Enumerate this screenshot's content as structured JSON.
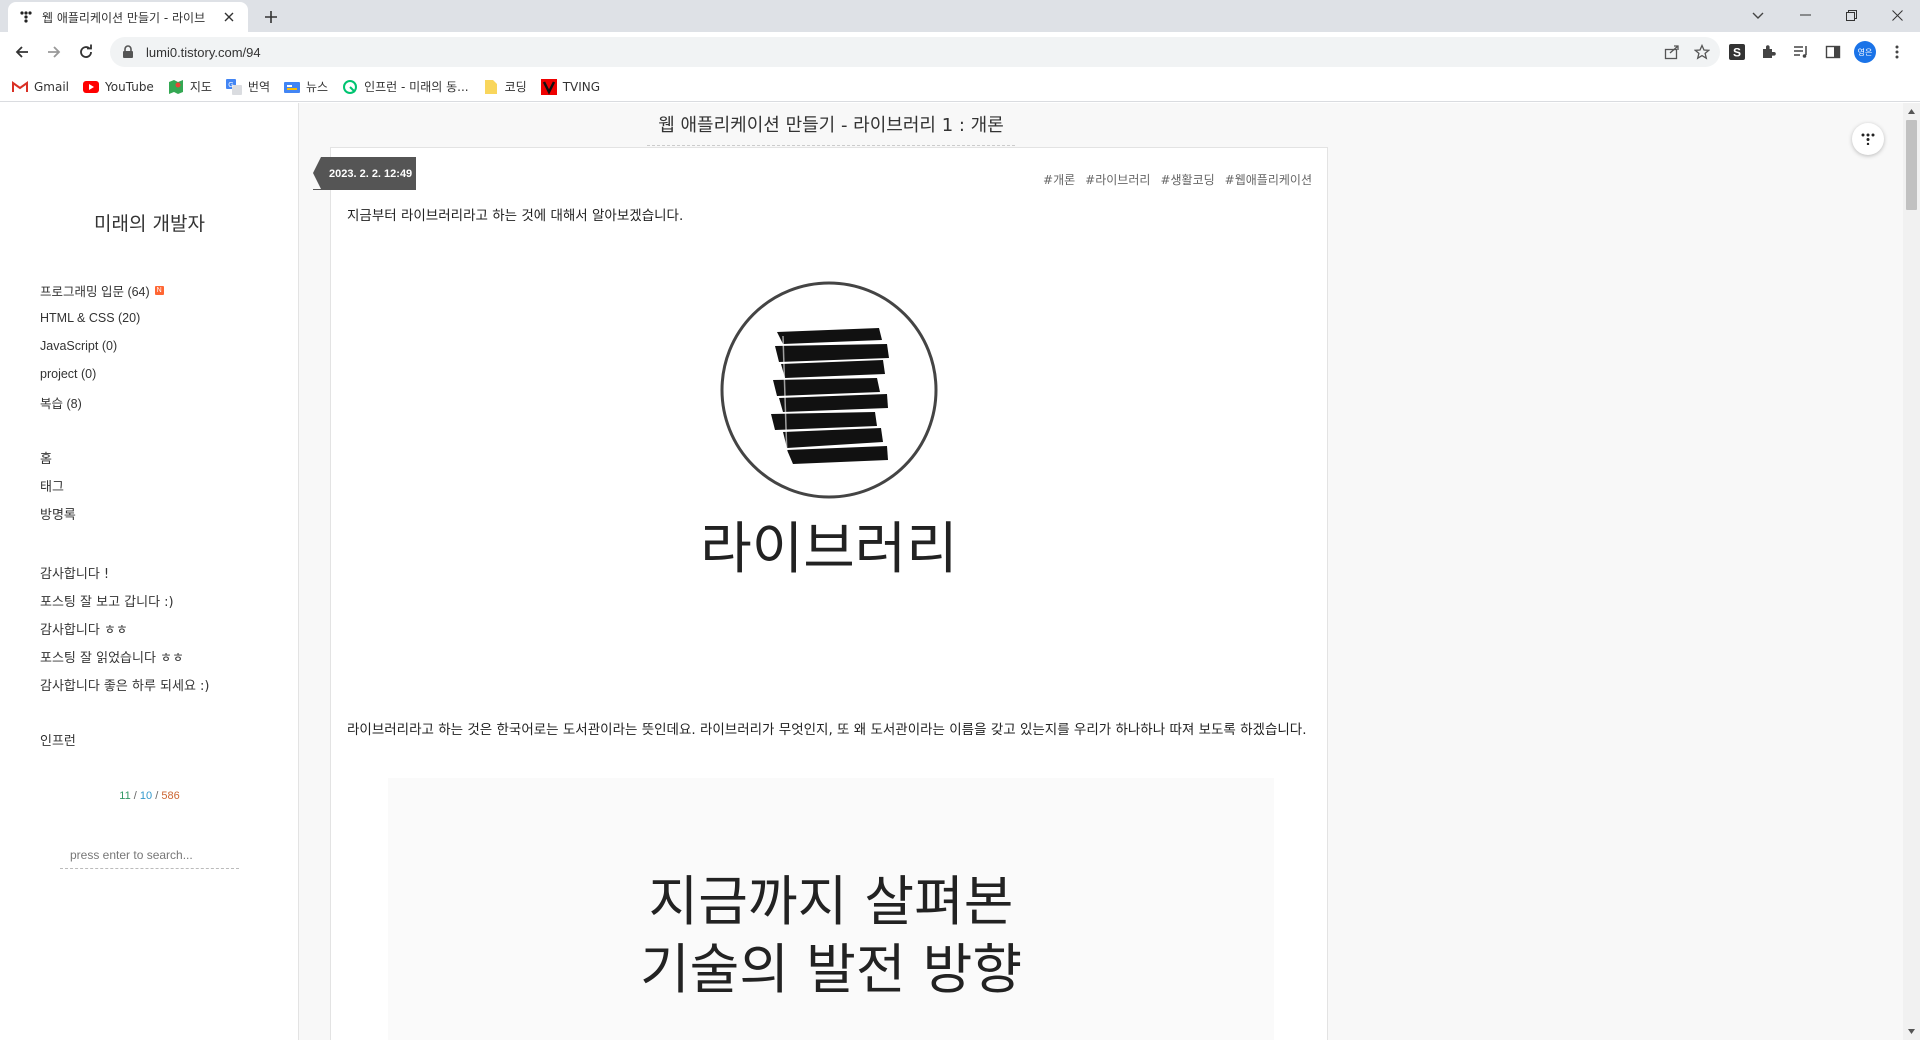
{
  "browser": {
    "tab_title": "웹 애플리케이션 만들기 - 라이브",
    "url": "lumi0.tistory.com/94",
    "profile_initials": "영은"
  },
  "bookmarks": [
    {
      "label": "Gmail",
      "icon": "gmail-icon"
    },
    {
      "label": "YouTube",
      "icon": "youtube-icon"
    },
    {
      "label": "지도",
      "icon": "maps-icon"
    },
    {
      "label": "번역",
      "icon": "translate-icon"
    },
    {
      "label": "뉴스",
      "icon": "news-icon"
    },
    {
      "label": "인프런 - 미래의 동...",
      "icon": "inflearn-icon"
    },
    {
      "label": "코딩",
      "icon": "folder-icon"
    },
    {
      "label": "TVING",
      "icon": "tving-icon"
    }
  ],
  "sidebar": {
    "blog_title": "미래의 개발자",
    "categories": [
      {
        "label": "프로그래밍 입문 (64)",
        "badge": "N"
      },
      {
        "label": "HTML & CSS (20)"
      },
      {
        "label": "JavaScript (0)"
      },
      {
        "label": "project (0)"
      },
      {
        "label": "복습 (8)"
      }
    ],
    "menu": [
      "홈",
      "태그",
      "방명록"
    ],
    "recent_comments": [
      "감사합니다 !",
      "포스팅 잘 보고 갑니다 :)",
      "감사합니다 ㅎㅎ",
      "포스팅 잘 읽었습니다 ㅎㅎ",
      "감사합니다 좋은 하루 되세요 :)"
    ],
    "link": "인프런",
    "counter": {
      "total": "11",
      "today": "10",
      "yesterday": "586",
      "sep": "/"
    },
    "search_placeholder": "press enter to search..."
  },
  "post": {
    "title": "웹 애플리케이션 만들기 - 라이브러리 1 : 개론",
    "date": "2023. 2. 2. 12:49",
    "tags": [
      "#개론",
      "#라이브러리",
      "#생활코딩",
      "#웹애플리케이션"
    ],
    "paragraph1": "지금부터 라이브러리라고 하는 것에 대해서 알아보겠습니다.",
    "image1_caption": "라이브러리",
    "paragraph2": "라이브러리라고 하는 것은 한국어로는 도서관이라는 뜻인데요. 라이브러리가 무엇인지, 또 왜 도서관이라는 이름을 갖고 있는지를 우리가 하나하나 따져 보도록 하겠습니다.",
    "image2_line1": "지금까지 살펴본",
    "image2_line2": "기술의 발전 방향"
  }
}
